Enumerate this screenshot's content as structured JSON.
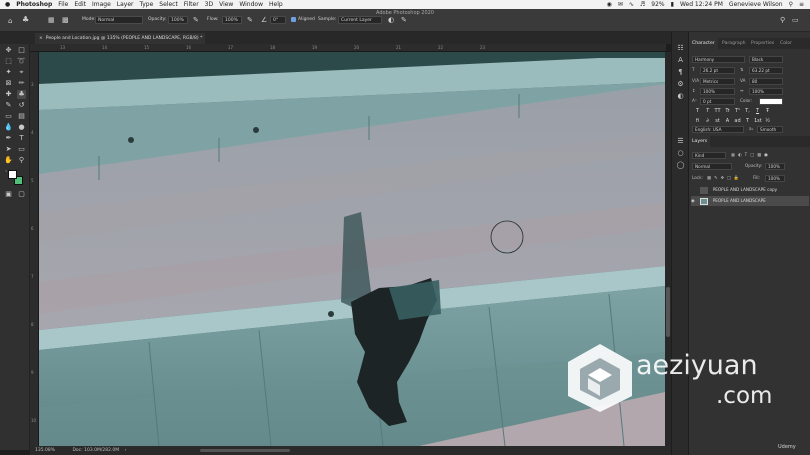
{
  "menubar": {
    "app_name": "Photoshop",
    "items": [
      "File",
      "Edit",
      "Image",
      "Layer",
      "Type",
      "Select",
      "Filter",
      "3D",
      "View",
      "Window",
      "Help"
    ],
    "battery": "92%",
    "datetime": "Wed 12:24 PM",
    "user": "Genevieve Wilson"
  },
  "window": {
    "title": "Adobe Photoshop 2020"
  },
  "options_bar": {
    "mode_label": "Mode:",
    "mode_value": "Normal",
    "opacity_label": "Opacity:",
    "opacity_value": "100%",
    "flow_label": "Flow:",
    "flow_value": "100%",
    "angle_value": "0°",
    "aligned_label": "Aligned",
    "sample_label": "Sample:",
    "sample_value": "Current Layer"
  },
  "document": {
    "tab_title": "People and Location.jpg @ 135% (PEOPLE AND LANDSCAPE, RGB/8) *",
    "zoom": "135.08%",
    "doc_info": "Doc: 103.0M/282.0M"
  },
  "rulers": {
    "top": [
      "13",
      "14",
      "15",
      "16",
      "17",
      "18",
      "19",
      "20",
      "21",
      "22",
      "23"
    ],
    "left": [
      "3",
      "4",
      "5",
      "6",
      "7",
      "8",
      "9",
      "10"
    ]
  },
  "character_panel": {
    "tabs": [
      "Character",
      "Paragraph",
      "Properties",
      "Color"
    ],
    "font_family": "Harmony",
    "font_style": "Black",
    "font_size": "26.2 pt",
    "leading": "63.22 pt",
    "kerning": "Metrics",
    "tracking": "80",
    "vertical_scale": "100%",
    "horizontal_scale": "100%",
    "baseline_shift": "0 pt",
    "color_label": "Color:",
    "type_style_buttons": [
      "T",
      "T",
      "TT",
      "Tr",
      "T¹",
      "T,",
      "T",
      "Ŧ"
    ],
    "opentype_buttons": [
      "fi",
      "∂",
      "st",
      "A",
      "ad",
      "T",
      "1st",
      "½"
    ],
    "language": "English: USA",
    "antialias": "Smooth"
  },
  "layers_panel": {
    "tab": "Layers",
    "filter_kind": "Kind",
    "blend_mode": "Normal",
    "opacity_label": "Opacity:",
    "opacity_value": "100%",
    "lock_label": "Lock:",
    "fill_label": "Fill:",
    "fill_value": "100%",
    "layers": [
      {
        "name": "PEOPLE AND LANDSCAPE copy",
        "visible": false,
        "selected": false
      },
      {
        "name": "PEOPLE AND LANDSCAPE",
        "visible": true,
        "selected": true
      }
    ]
  },
  "watermark": {
    "line1": "aeziyuan",
    "line2": ".com"
  },
  "udemy": "Udemy",
  "colors": {
    "foreground": "#ffffff",
    "background": "#4ec07a",
    "text_color_swatch": "#ffffff"
  }
}
